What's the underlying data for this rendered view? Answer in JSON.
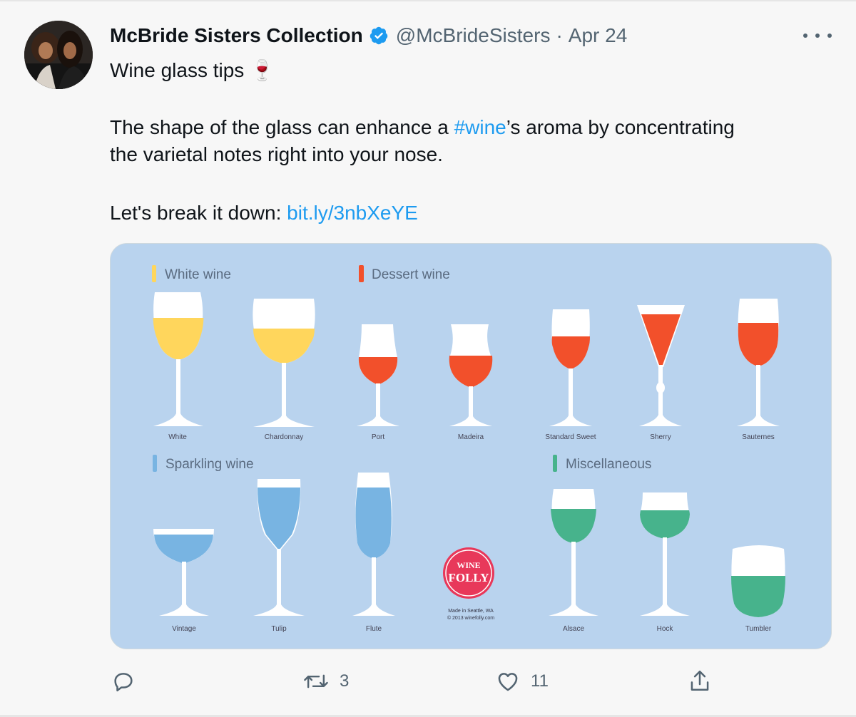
{
  "tweet": {
    "author_name": "McBride Sisters Collection",
    "handle": "@McBrideSisters",
    "date": "Apr 24",
    "line1_text": "Wine glass tips ",
    "line1_emoji": "🍷",
    "line2_before": "The shape of the glass can enhance a ",
    "line2_hashtag": "#wine",
    "line2_after": "’s aroma by concentrating",
    "line3": "the varietal notes right into your nose.",
    "line4_label": "Let's break it down: ",
    "line4_link": "bit.ly/3nbXeYE"
  },
  "infographic": {
    "sections": {
      "white": "White wine",
      "dessert": "Dessert wine",
      "sparkling": "Sparkling wine",
      "misc": "Miscellaneous"
    },
    "glasses": {
      "white": "White",
      "chardonnay": "Chardonnay",
      "port": "Port",
      "madeira": "Madeira",
      "standard_sweet": "Standard Sweet",
      "sherry": "Sherry",
      "sauternes": "Sauternes",
      "vintage": "Vintage",
      "tulip": "Tulip",
      "flute": "Flute",
      "alsace": "Alsace",
      "hock": "Hock",
      "tumbler": "Tumbler"
    },
    "logo_top": "WINE",
    "logo_bottom": "FOLLY",
    "credit_line1": "Made in Seattle, WA",
    "credit_line2": "© 2013 winefolly.com",
    "colors": {
      "background": "#b9d3ee",
      "white_wine": "#ffd65c",
      "dessert_wine": "#f2502b",
      "sparkling_wine": "#78b4e2",
      "misc_wine": "#47b38c"
    }
  },
  "actions": {
    "reply_count": "",
    "retweet_count": "3",
    "like_count": "11"
  }
}
